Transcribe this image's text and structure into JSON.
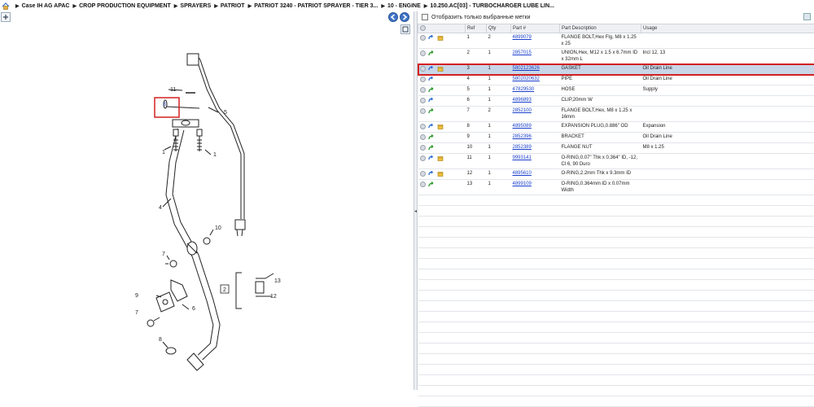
{
  "breadcrumb": {
    "home_icon": "home-icon",
    "items": [
      "Case IH AG APAC",
      "CROP PRODUCTION EQUIPMENT",
      "SPRAYERS",
      "PATRIOT",
      "PATRIOT 3240 - PATRIOT SPRAYER - TIER 3...",
      "10 - ENGINE",
      "10.250.AC[03] - TURBOCHARGER LUBE LIN..."
    ]
  },
  "toolbar": {
    "expand_icon": "expand-icon",
    "prev_icon": "back-arrow-icon",
    "next_icon": "forward-arrow-icon",
    "fit_icon": "fit-icon"
  },
  "filter": {
    "label": "Отобразить только выбранные метки",
    "checked": false
  },
  "table": {
    "headers": [
      "",
      "Ref",
      "Qty",
      "Part #",
      "Part Description",
      "Usage"
    ],
    "rows": [
      {
        "icons": [
          "circle",
          "blue",
          "box"
        ],
        "ref": "1",
        "qty": "2",
        "part": "4899079",
        "desc": "FLANGE BOLT,Hex Flg, M8 x 1.25 x 25",
        "usage": "",
        "selected": false
      },
      {
        "icons": [
          "circle",
          "green"
        ],
        "ref": "2",
        "qty": "1",
        "part": "2857015",
        "desc": "UNION,Hex, M12 x 1.5 x 6.7mm ID x 32mm L",
        "usage": "Incl 12, 13",
        "selected": false
      },
      {
        "icons": [
          "circle",
          "blue",
          "box"
        ],
        "ref": "3",
        "qty": "1",
        "part": "5802123626",
        "desc": "GASKET",
        "usage": "Oil Drain Line",
        "selected": true
      },
      {
        "icons": [
          "circle",
          "blue"
        ],
        "ref": "4",
        "qty": "1",
        "part": "5802020632",
        "desc": "PIPE",
        "usage": "Oil Drain Line",
        "selected": false
      },
      {
        "icons": [
          "circle",
          "green"
        ],
        "ref": "5",
        "qty": "1",
        "part": "47829530",
        "desc": "HOSE",
        "usage": "Supply",
        "selected": false
      },
      {
        "icons": [
          "circle",
          "blue"
        ],
        "ref": "6",
        "qty": "1",
        "part": "4896893",
        "desc": "CLIP,20mm W",
        "usage": "",
        "selected": false
      },
      {
        "icons": [
          "circle",
          "green"
        ],
        "ref": "7",
        "qty": "2",
        "part": "2852100",
        "desc": "FLANGE BOLT,Hex, M8 x 1.25 x 16mm",
        "usage": "",
        "selected": false
      },
      {
        "icons": [
          "circle",
          "blue",
          "box"
        ],
        "ref": "8",
        "qty": "1",
        "part": "4895089",
        "desc": "EXPANSION PLUG,0.886\" OD",
        "usage": "Expansion",
        "selected": false
      },
      {
        "icons": [
          "circle",
          "green"
        ],
        "ref": "9",
        "qty": "1",
        "part": "2852396",
        "desc": "BRACKET",
        "usage": "Oil Drain Line",
        "selected": false
      },
      {
        "icons": [
          "circle",
          "green"
        ],
        "ref": "10",
        "qty": "1",
        "part": "2852389",
        "desc": "FLANGE NUT",
        "usage": "M8 x 1.25",
        "selected": false
      },
      {
        "icons": [
          "circle",
          "blue",
          "box"
        ],
        "ref": "11",
        "qty": "1",
        "part": "9993141",
        "desc": "O-RING,0.07\" Thk x 0.364\" ID, -12, Cl 6, 90 Duro",
        "usage": "",
        "selected": false
      },
      {
        "icons": [
          "circle",
          "blue",
          "box"
        ],
        "ref": "12",
        "qty": "1",
        "part": "4895610",
        "desc": "O-RING,2.2mm Thk x 9.3mm ID",
        "usage": "",
        "selected": false
      },
      {
        "icons": [
          "circle",
          "green"
        ],
        "ref": "13",
        "qty": "1",
        "part": "4899109",
        "desc": "O-RING,0.364mm ID x 0.07mm Width",
        "usage": "",
        "selected": false
      }
    ]
  },
  "diagram": {
    "labels": {
      "l1a": "1",
      "l1b": "1",
      "l2": "2",
      "l3": "3",
      "l4": "4",
      "l5": "5",
      "l6": "6",
      "l7a": "7",
      "l7b": "7",
      "l8": "8",
      "l9": "9",
      "l10": "10",
      "l11": "11",
      "l12": "12",
      "l13": "13"
    }
  },
  "colors": {
    "highlight": "#d32020",
    "selected_row": "#c9d6e8",
    "link": "#1a3fcc",
    "nav_blue": "#3f74c6"
  }
}
